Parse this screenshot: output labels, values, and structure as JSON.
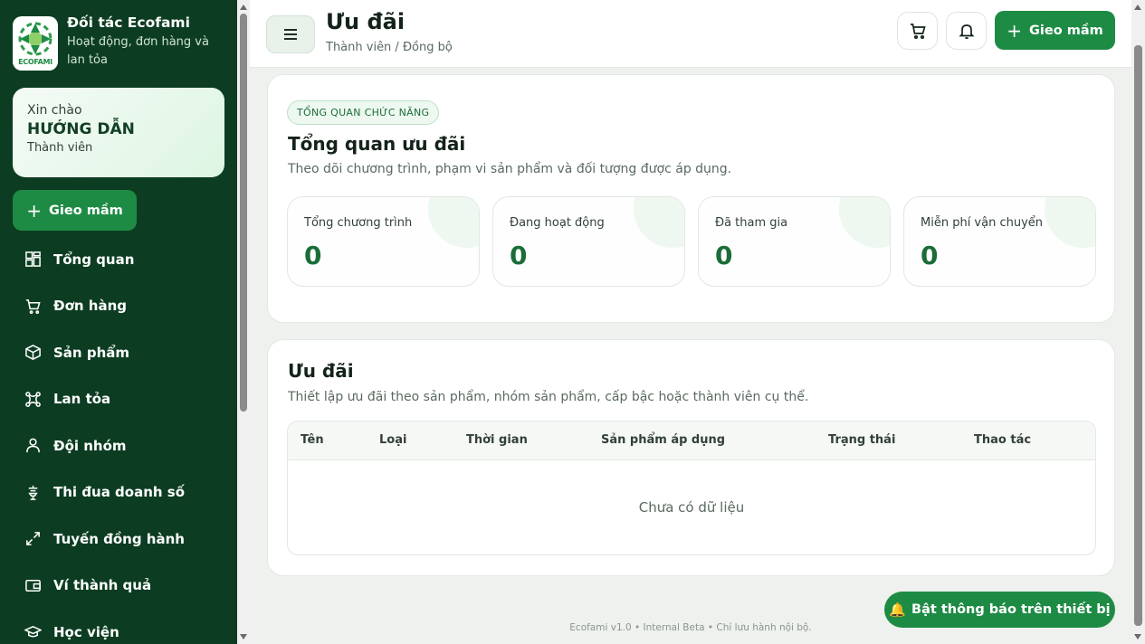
{
  "brand": {
    "name": "Đối tác Ecofami",
    "subtitle": "Hoạt động, đơn hàng và lan tỏa",
    "logo_text": "ECOFAMI"
  },
  "greeting": {
    "hello": "Xin chào",
    "name": "HƯỚNG DẪN",
    "role": "Thành viên"
  },
  "sidebar_cta": "Gieo mầm",
  "nav": [
    {
      "label": "Tổng quan",
      "icon": "dashboard-icon"
    },
    {
      "label": "Đơn hàng",
      "icon": "cart-icon"
    },
    {
      "label": "Sản phẩm",
      "icon": "box-icon"
    },
    {
      "label": "Lan tỏa",
      "icon": "share-icon"
    },
    {
      "label": "Đội nhóm",
      "icon": "user-icon"
    },
    {
      "label": "Thi đua doanh số",
      "icon": "trophy-icon"
    },
    {
      "label": "Tuyến đồng hành",
      "icon": "route-icon"
    },
    {
      "label": "Ví thành quả",
      "icon": "wallet-icon"
    },
    {
      "label": "Học viện",
      "icon": "graduation-icon"
    }
  ],
  "header": {
    "title": "Ưu đãi",
    "breadcrumb": "Thành viên / Đồng bộ",
    "cta": "Gieo mầm"
  },
  "overview": {
    "pill": "TỔNG QUAN CHỨC NĂNG",
    "title": "Tổng quan ưu đãi",
    "description": "Theo dõi chương trình, phạm vi sản phẩm và đối tượng được áp dụng.",
    "stats": [
      {
        "label": "Tổng chương trình",
        "value": "0"
      },
      {
        "label": "Đang hoạt động",
        "value": "0"
      },
      {
        "label": "Đã tham gia",
        "value": "0"
      },
      {
        "label": "Miễn phí vận chuyển",
        "value": "0"
      }
    ]
  },
  "offers": {
    "title": "Ưu đãi",
    "description": "Thiết lập ưu đãi theo sản phẩm, nhóm sản phẩm, cấp bậc hoặc thành viên cụ thể.",
    "columns": [
      "Tên",
      "Loại",
      "Thời gian",
      "Sản phẩm áp dụng",
      "Trạng thái",
      "Thao tác"
    ],
    "empty": "Chưa có dữ liệu"
  },
  "footer": "Ecofami v1.0 • Internal Beta • Chỉ lưu hành nội bộ.",
  "notify_button": "Bật thông báo trên thiết bị",
  "colors": {
    "sidebar": "#0c3d22",
    "primary": "#1e8b45",
    "accent_text": "#1b6d38"
  }
}
